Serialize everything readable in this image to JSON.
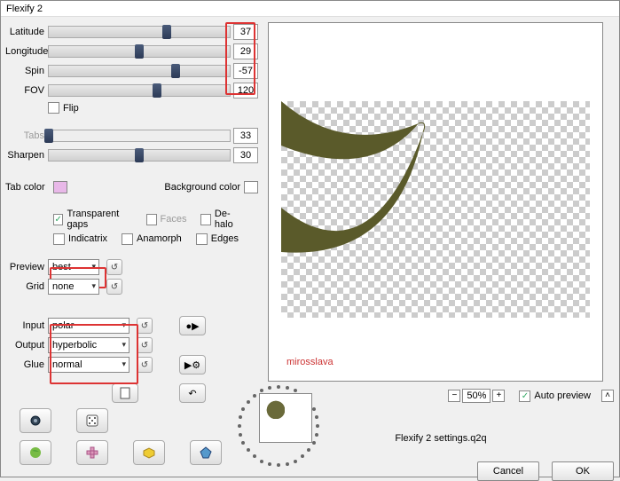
{
  "title": "Flexify 2",
  "sliders": {
    "latitude": {
      "label": "Latitude",
      "value": "37",
      "pos": "65%"
    },
    "longitude": {
      "label": "Longitude",
      "value": "29",
      "pos": "50%"
    },
    "spin": {
      "label": "Spin",
      "value": "-57",
      "pos": "70%"
    },
    "fov": {
      "label": "FOV",
      "value": "120",
      "pos": "60%"
    },
    "tabs": {
      "label": "Tabs",
      "value": "33",
      "pos": "0%"
    },
    "sharpen": {
      "label": "Sharpen",
      "value": "30",
      "pos": "50%"
    }
  },
  "flip": "Flip",
  "tabcolor": "Tab color",
  "bgcolor": "Background color",
  "checks": {
    "tg": "Transparent gaps",
    "faces": "Faces",
    "dehalo": "De-halo",
    "ind": "Indicatrix",
    "ana": "Anamorph",
    "edges": "Edges"
  },
  "preview_lbl": "Preview",
  "preview_val": "best",
  "grid_lbl": "Grid",
  "grid_val": "none",
  "input_lbl": "Input",
  "input_val": "polar",
  "output_lbl": "Output",
  "output_val": "hyperbolic",
  "glue_lbl": "Glue",
  "glue_val": "normal",
  "zoom": "50%",
  "autoprev": "Auto preview",
  "settings": "Flexify 2 settings.q2q",
  "sig": "mirosslava",
  "cancel": "Cancel",
  "ok": "OK",
  "colors": {
    "tab": "#e8b8e8",
    "bg": "#ffffff"
  }
}
